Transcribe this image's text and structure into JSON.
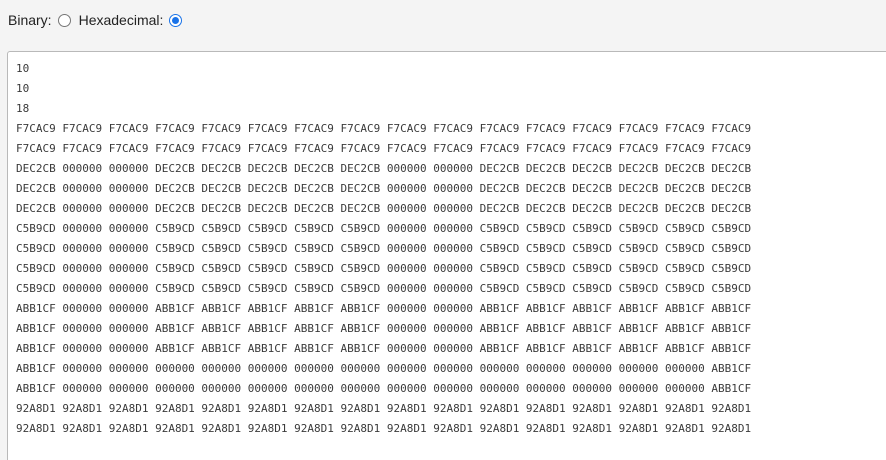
{
  "mode": {
    "binary_label": "Binary:",
    "hex_label": "Hexadecimal:",
    "selected": "hexadecimal"
  },
  "output_lines": [
    "10",
    "10",
    "18",
    "F7CAC9 F7CAC9 F7CAC9 F7CAC9 F7CAC9 F7CAC9 F7CAC9 F7CAC9 F7CAC9 F7CAC9 F7CAC9 F7CAC9 F7CAC9 F7CAC9 F7CAC9 F7CAC9",
    "F7CAC9 F7CAC9 F7CAC9 F7CAC9 F7CAC9 F7CAC9 F7CAC9 F7CAC9 F7CAC9 F7CAC9 F7CAC9 F7CAC9 F7CAC9 F7CAC9 F7CAC9 F7CAC9",
    "DEC2CB 000000 000000 DEC2CB DEC2CB DEC2CB DEC2CB DEC2CB 000000 000000 DEC2CB DEC2CB DEC2CB DEC2CB DEC2CB DEC2CB",
    "DEC2CB 000000 000000 DEC2CB DEC2CB DEC2CB DEC2CB DEC2CB 000000 000000 DEC2CB DEC2CB DEC2CB DEC2CB DEC2CB DEC2CB",
    "DEC2CB 000000 000000 DEC2CB DEC2CB DEC2CB DEC2CB DEC2CB 000000 000000 DEC2CB DEC2CB DEC2CB DEC2CB DEC2CB DEC2CB",
    "C5B9CD 000000 000000 C5B9CD C5B9CD C5B9CD C5B9CD C5B9CD 000000 000000 C5B9CD C5B9CD C5B9CD C5B9CD C5B9CD C5B9CD",
    "C5B9CD 000000 000000 C5B9CD C5B9CD C5B9CD C5B9CD C5B9CD 000000 000000 C5B9CD C5B9CD C5B9CD C5B9CD C5B9CD C5B9CD",
    "C5B9CD 000000 000000 C5B9CD C5B9CD C5B9CD C5B9CD C5B9CD 000000 000000 C5B9CD C5B9CD C5B9CD C5B9CD C5B9CD C5B9CD",
    "C5B9CD 000000 000000 C5B9CD C5B9CD C5B9CD C5B9CD C5B9CD 000000 000000 C5B9CD C5B9CD C5B9CD C5B9CD C5B9CD C5B9CD",
    "ABB1CF 000000 000000 ABB1CF ABB1CF ABB1CF ABB1CF ABB1CF 000000 000000 ABB1CF ABB1CF ABB1CF ABB1CF ABB1CF ABB1CF",
    "ABB1CF 000000 000000 ABB1CF ABB1CF ABB1CF ABB1CF ABB1CF 000000 000000 ABB1CF ABB1CF ABB1CF ABB1CF ABB1CF ABB1CF",
    "ABB1CF 000000 000000 ABB1CF ABB1CF ABB1CF ABB1CF ABB1CF 000000 000000 ABB1CF ABB1CF ABB1CF ABB1CF ABB1CF ABB1CF",
    "ABB1CF 000000 000000 000000 000000 000000 000000 000000 000000 000000 000000 000000 000000 000000 000000 ABB1CF",
    "ABB1CF 000000 000000 000000 000000 000000 000000 000000 000000 000000 000000 000000 000000 000000 000000 ABB1CF",
    "92A8D1 92A8D1 92A8D1 92A8D1 92A8D1 92A8D1 92A8D1 92A8D1 92A8D1 92A8D1 92A8D1 92A8D1 92A8D1 92A8D1 92A8D1 92A8D1",
    "92A8D1 92A8D1 92A8D1 92A8D1 92A8D1 92A8D1 92A8D1 92A8D1 92A8D1 92A8D1 92A8D1 92A8D1 92A8D1 92A8D1 92A8D1 92A8D1"
  ],
  "colors": {
    "page_background": "#f4f4f4",
    "panel_background": "#ffffff",
    "text": "#3a3a3a",
    "accent": "#1a73e8"
  }
}
